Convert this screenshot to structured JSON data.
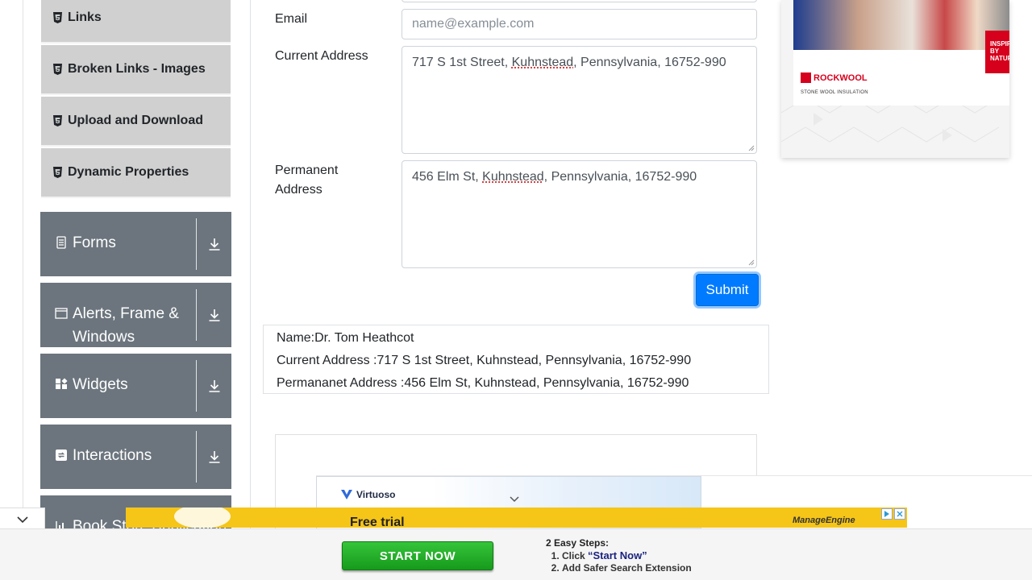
{
  "sidebar": {
    "sub_items": [
      "Links",
      "Broken Links - Images",
      "Upload and Download",
      "Dynamic Properties"
    ],
    "groups": [
      "Forms",
      "Alerts, Frame & Windows",
      "Widgets",
      "Interactions",
      "Book Store Application"
    ]
  },
  "form": {
    "email_label": "Email",
    "email_placeholder": "name@example.com",
    "current_address_label": "Current Address",
    "current_address": {
      "pre": "717 S 1st Street, ",
      "spell": "Kuhnstead",
      "post": ", Pennsylvania, 16752-990"
    },
    "permanent_address_label": "Permanent Address",
    "permanent_address": {
      "pre": "456 Elm St, ",
      "spell": "Kuhnstead",
      "post": ", Pennsylvania, 16752-990"
    },
    "submit_label": "Submit"
  },
  "output": {
    "name": "Name:Dr. Tom Heathcot",
    "current_address": "Current Address :717 S 1st Street, Kuhnstead, Pennsylvania, 16752-990",
    "permanent_address": "Permananet Address :456 Elm St, Kuhnstead, Pennsylvania, 16752-990"
  },
  "ads": {
    "rockwool_brand": "ROCKWOOL",
    "rockwool_tagline": "STONE WOOL INSULATION",
    "inspired": "INSPIRED BY NATURE.",
    "virtuoso_brand": "Virtuoso",
    "free_trial": "Free trial",
    "manageengine": "ManageEngine",
    "start_now": "START NOW",
    "steps_title": "2 Easy Steps:",
    "step1_pre": "Click ",
    "step1_q": "“Start Now”",
    "step2": "Add Safer Search Extension"
  },
  "colors": {
    "primary": "#007bff",
    "group_bg": "#6c757d",
    "sub_bg": "#d0d0d0",
    "ad_yellow": "#f5c518",
    "ad_red": "#d6001c"
  }
}
